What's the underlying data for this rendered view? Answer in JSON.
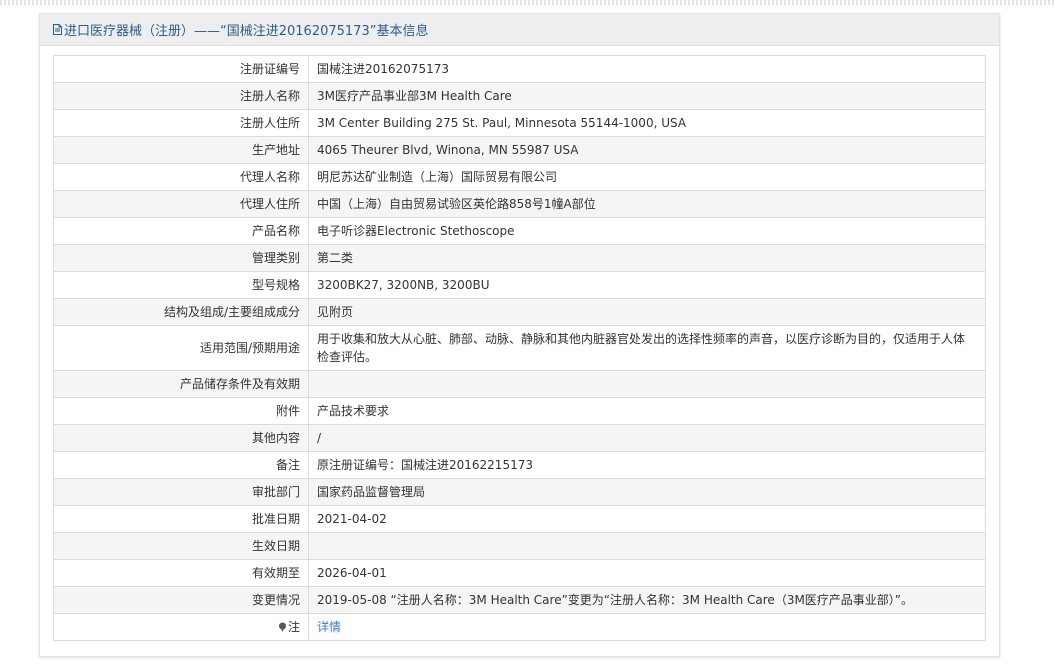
{
  "title": "进口医疗器械（注册）——“国械注进20162075173”基本信息",
  "rows": [
    {
      "label": "注册证编号",
      "value": "国械注进20162075173"
    },
    {
      "label": "注册人名称",
      "value": "3M医疗产品事业部3M Health Care"
    },
    {
      "label": "注册人住所",
      "value": "3M Center Building 275 St. Paul, Minnesota 55144-1000, USA"
    },
    {
      "label": "生产地址",
      "value": "4065 Theurer Blvd, Winona, MN 55987 USA"
    },
    {
      "label": "代理人名称",
      "value": "明尼苏达矿业制造（上海）国际贸易有限公司"
    },
    {
      "label": "代理人住所",
      "value": "中国（上海）自由贸易试验区英伦路858号1幢A部位"
    },
    {
      "label": "产品名称",
      "value": "电子听诊器Electronic Stethoscope"
    },
    {
      "label": "管理类别",
      "value": "第二类"
    },
    {
      "label": "型号规格",
      "value": "3200BK27, 3200NB, 3200BU"
    },
    {
      "label": "结构及组成/主要组成成分",
      "value": "见附页"
    },
    {
      "label": "适用范围/预期用途",
      "value": "用于收集和放大从心脏、肺部、动脉、静脉和其他内脏器官处发出的选择性频率的声音，以医疗诊断为目的，仅适用于人体检查评估。"
    },
    {
      "label": "产品储存条件及有效期",
      "value": ""
    },
    {
      "label": "附件",
      "value": "产品技术要求"
    },
    {
      "label": "其他内容",
      "value": "/"
    },
    {
      "label": "备注",
      "value": "原注册证编号：国械注进20162215173"
    },
    {
      "label": "审批部门",
      "value": "国家药品监督管理局"
    },
    {
      "label": "批准日期",
      "value": "2021-04-02"
    },
    {
      "label": "生效日期",
      "value": ""
    },
    {
      "label": "有效期至",
      "value": "2026-04-01"
    },
    {
      "label": "变更情况",
      "value": "2019-05-08 “注册人名称：3M Health Care”变更为“注册人名称：3M Health Care（3M医疗产品事业部）”。"
    },
    {
      "label": "注",
      "value": "详情"
    }
  ],
  "icons": {
    "title": "document-icon",
    "note": "pin-icon"
  },
  "colors": {
    "title": "#2b5d8e",
    "link": "#3a7bc8"
  }
}
